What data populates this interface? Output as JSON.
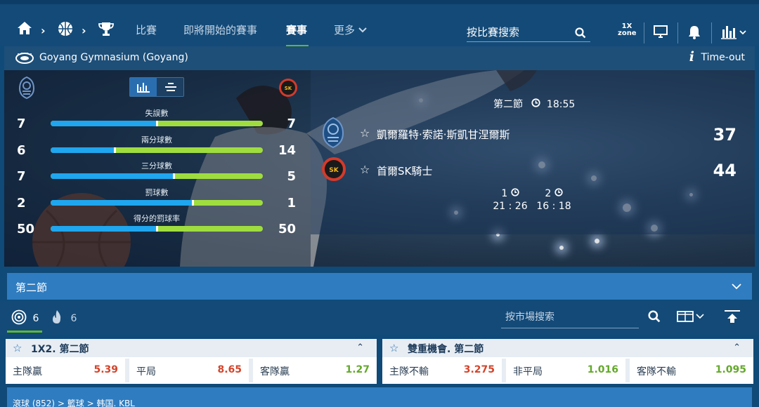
{
  "nav": {
    "items": [
      {
        "label": "比賽",
        "active": false
      },
      {
        "label": "即將開始的賽事",
        "active": false
      },
      {
        "label": "賽事",
        "active": true
      },
      {
        "label": "更多",
        "active": false
      }
    ],
    "search_placeholder": "按比賽搜索",
    "zone_badge": {
      "top": "1X",
      "bottom": "zone"
    }
  },
  "venue": {
    "name": "Goyang Gymnasium (Goyang)",
    "status": "Time-out",
    "status_icon": "i"
  },
  "stats": [
    {
      "label": "失誤數",
      "home": "7",
      "away": "7",
      "home_share": 0.5
    },
    {
      "label": "兩分球數",
      "home": "6",
      "away": "14",
      "home_share": 0.3
    },
    {
      "label": "三分球數",
      "home": "7",
      "away": "5",
      "home_share": 0.58
    },
    {
      "label": "罰球數",
      "home": "2",
      "away": "1",
      "home_share": 0.67
    },
    {
      "label": "得分的罰球率",
      "home": "50",
      "away": "50",
      "home_share": 0.5
    }
  ],
  "match": {
    "period": "第二節",
    "clock": "18:55",
    "home": {
      "name": "凱爾羅特·索諾·斯凱甘涅爾斯",
      "score": "37"
    },
    "away": {
      "name": "首爾SK騎士",
      "score": "44"
    },
    "quarters": [
      {
        "label": "1",
        "score": "21 : 26"
      },
      {
        "label": "2",
        "score": "16 : 18"
      }
    ]
  },
  "period_bar": {
    "label": "第二節"
  },
  "market_tools": {
    "tabs": [
      {
        "count": "6"
      },
      {
        "count": "6"
      }
    ],
    "search_placeholder": "按市場搜索"
  },
  "markets": [
    {
      "title": "1X2. 第二節",
      "odds": [
        {
          "label": "主隊贏",
          "value": "5.39",
          "color": "red"
        },
        {
          "label": "平局",
          "value": "8.65",
          "color": "red"
        },
        {
          "label": "客隊贏",
          "value": "1.27",
          "color": "green"
        }
      ]
    },
    {
      "title": "雙重機會. 第二節",
      "odds": [
        {
          "label": "主隊不輸",
          "value": "3.275",
          "color": "red"
        },
        {
          "label": "非平局",
          "value": "1.016",
          "color": "green"
        },
        {
          "label": "客隊不輸",
          "value": "1.095",
          "color": "green"
        }
      ]
    }
  ],
  "footer": {
    "breadcrumb": "滾球 (852) > 籃球 > 韩国. KBL"
  },
  "colors": {
    "nav_bg": "#134a78",
    "accent_green": "#5fb92e",
    "bar_blue": "#1fa6ee",
    "bar_green": "#9fdd3f",
    "odd_red": "#d2452c",
    "odd_green": "#64a82c"
  }
}
